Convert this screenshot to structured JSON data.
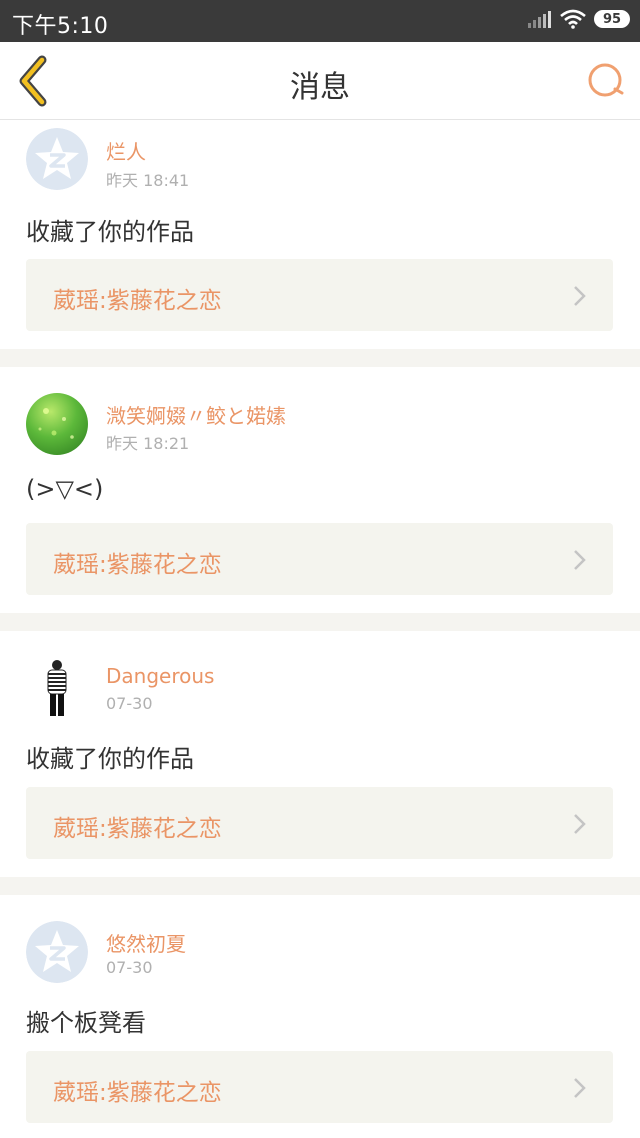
{
  "status_bar": {
    "time": "下午5:10",
    "battery": "95",
    "icons": [
      "signal-icon",
      "wifi-icon",
      "battery-icon"
    ]
  },
  "header": {
    "title": "消息",
    "back_icon": "chevron-left-icon",
    "search_icon": "search-icon"
  },
  "colors": {
    "accent": "#ea9566",
    "back_arrow": "#f2c021",
    "status_bar": "#3a3a3a",
    "link_background": "#f4f4ee"
  },
  "messages": [
    {
      "user": "烂人",
      "time": "昨天 18:41",
      "text": "收藏了你的作品",
      "work": "葳瑶:紫藤花之恋",
      "avatar": "default-qzone-avatar"
    },
    {
      "user": "溦笑婀娺〃鲛と婼嫊",
      "time": "昨天 18:21",
      "text": "(>▽<)",
      "work": "葳瑶:紫藤花之恋",
      "avatar": "green-bokeh-avatar"
    },
    {
      "user": "Dangerous",
      "time": "07-30",
      "text": "收藏了你的作品",
      "work": "葳瑶:紫藤花之恋",
      "avatar": "person-striped-shirt-avatar"
    },
    {
      "user": "悠然初夏",
      "time": "07-30",
      "text": "搬个板凳看",
      "work": "葳瑶:紫藤花之恋",
      "avatar": "default-qzone-avatar"
    }
  ]
}
